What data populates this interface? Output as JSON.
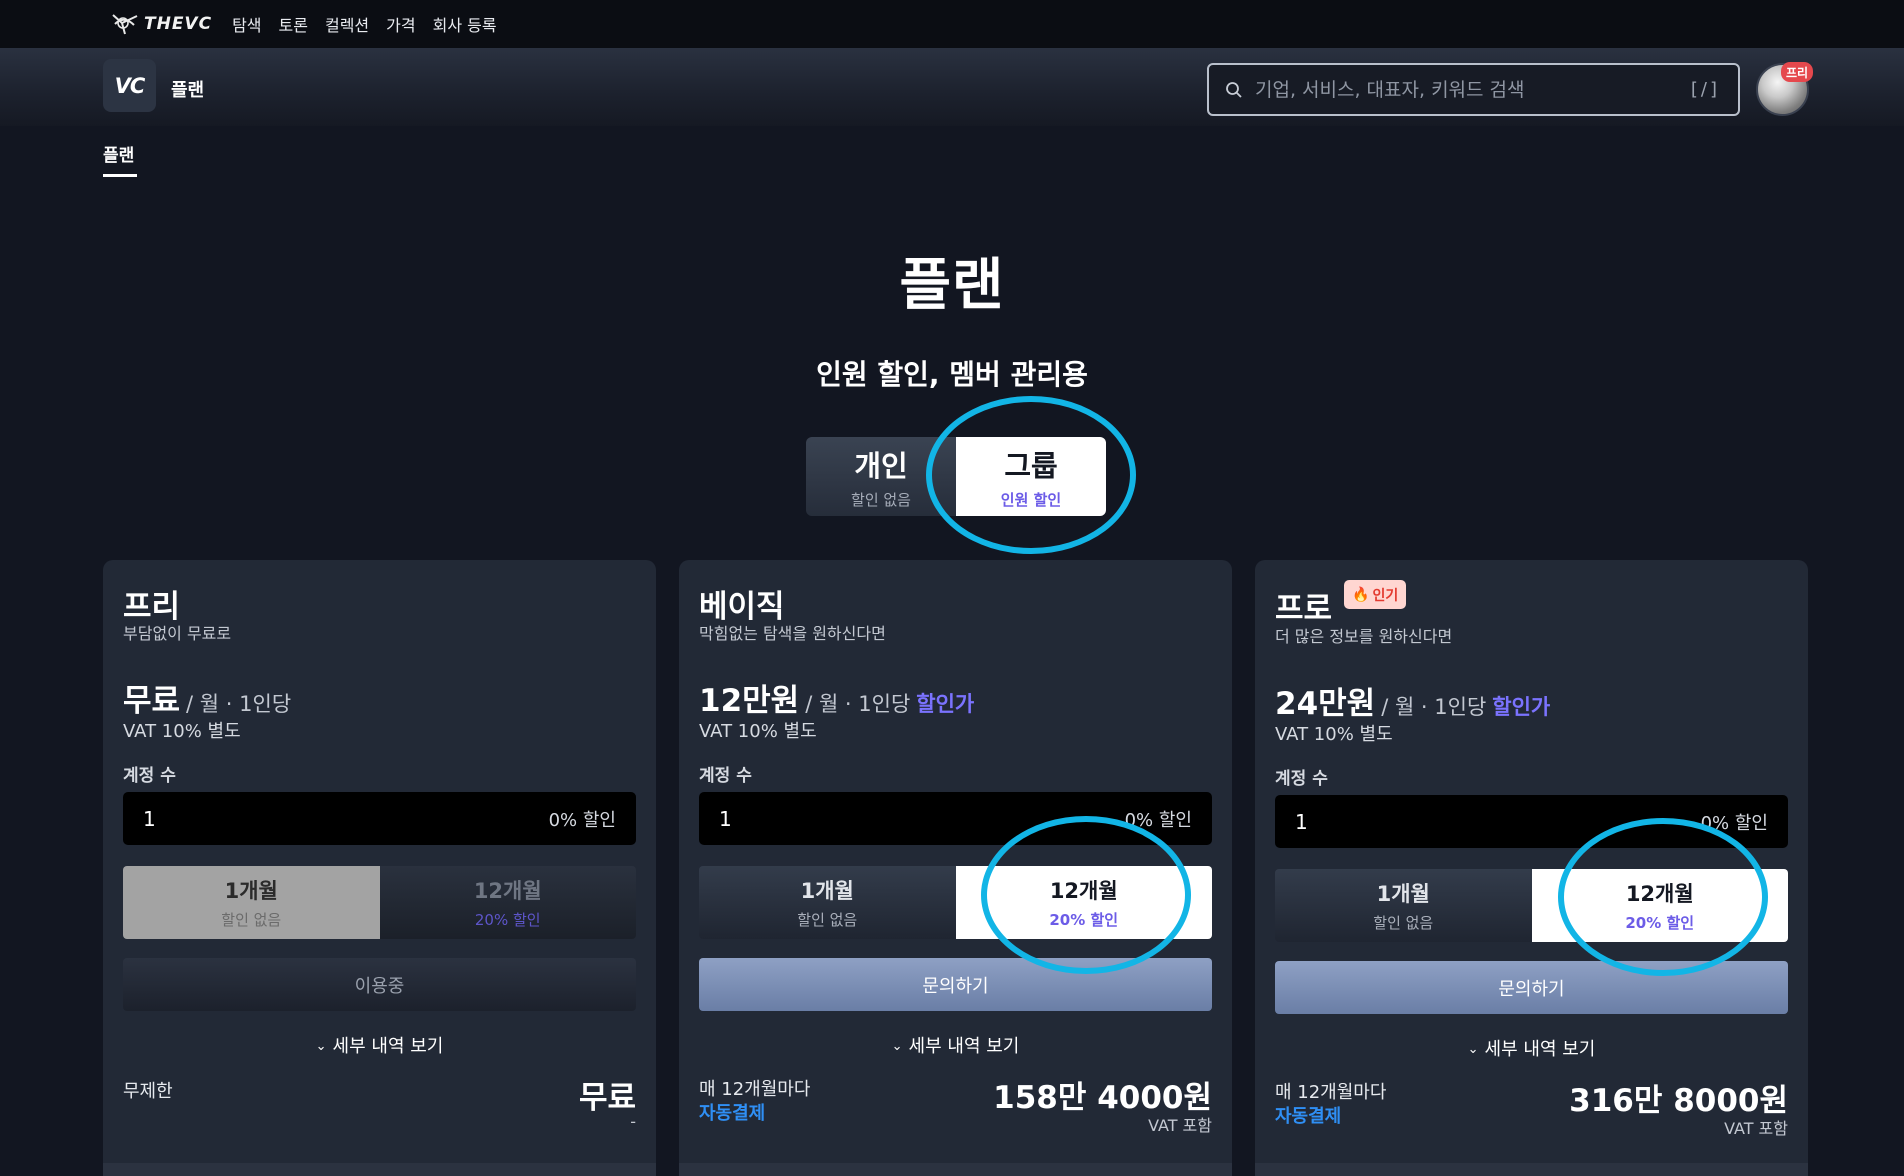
{
  "topnav": {
    "logo_text": "THEVC",
    "links": [
      "탐색",
      "토론",
      "컬렉션",
      "가격",
      "회사 등록"
    ]
  },
  "subheader": {
    "badge_text": "VC",
    "title": "플랜",
    "search_placeholder": "기업, 서비스, 대표자, 키워드 검색",
    "search_shortcut": "[/]",
    "avatar_badge": "프리"
  },
  "tab": {
    "label": "플랜"
  },
  "hero": {
    "title": "플랜",
    "subtitle": "인원 할인, 멤버 관리용"
  },
  "mode_toggle": {
    "personal": {
      "label": "개인",
      "sub": "할인 없음"
    },
    "group": {
      "label": "그룹",
      "sub": "인원 할인"
    },
    "selected": "group"
  },
  "plans": [
    {
      "name": "프리",
      "desc": "부담없이 무료로",
      "price": "무료",
      "per": "/ 월 · 1인당",
      "discount_link": "",
      "vat": "VAT 10% 별도",
      "seats_label": "계정 수",
      "seats_value": "1",
      "seats_discount": "0% 할인",
      "period_1m": {
        "label": "1개월",
        "sub": "할인 없음"
      },
      "period_12m": {
        "label": "12개월",
        "sub": "20% 할인"
      },
      "action": "이용중",
      "details": "세부 내역 보기",
      "total_left": "무제한",
      "total_right": "무료",
      "total_note": "-"
    },
    {
      "name": "베이직",
      "desc": "막힘없는 탐색을 원하신다면",
      "price": "12만원",
      "per": "/ 월 · 1인당",
      "discount_link": "할인가",
      "vat": "VAT 10% 별도",
      "seats_label": "계정 수",
      "seats_value": "1",
      "seats_discount": "0% 할인",
      "period_1m": {
        "label": "1개월",
        "sub": "할인 없음"
      },
      "period_12m": {
        "label": "12개월",
        "sub": "20% 할인"
      },
      "action": "문의하기",
      "details": "세부 내역 보기",
      "total_left": "매 12개월마다",
      "auto_pay": "자동결제",
      "total_right": "158만 4000원",
      "total_note": "VAT 포함"
    },
    {
      "name": "프로",
      "popular_badge": "인기",
      "desc": "더 많은 정보를 원하신다면",
      "price": "24만원",
      "per": "/ 월 · 1인당",
      "discount_link": "할인가",
      "vat": "VAT 10% 별도",
      "seats_label": "계정 수",
      "seats_value": "1",
      "seats_discount": "0% 할인",
      "period_1m": {
        "label": "1개월",
        "sub": "할인 없음"
      },
      "period_12m": {
        "label": "12개월",
        "sub": "20% 할인"
      },
      "action": "문의하기",
      "details": "세부 내역 보기",
      "total_left": "매 12개월마다",
      "auto_pay": "자동결제",
      "total_right": "316만 8000원",
      "total_note": "VAT 포함"
    }
  ],
  "colors": {
    "background": "#121621",
    "card": "#222936",
    "accent_purple": "#6c5ce7",
    "auto_pay_blue": "#2f8ff5",
    "highlight_circle": "#12b5e6",
    "popular_badge_bg": "#ffd6d1",
    "popular_badge_text": "#e33a2f"
  }
}
